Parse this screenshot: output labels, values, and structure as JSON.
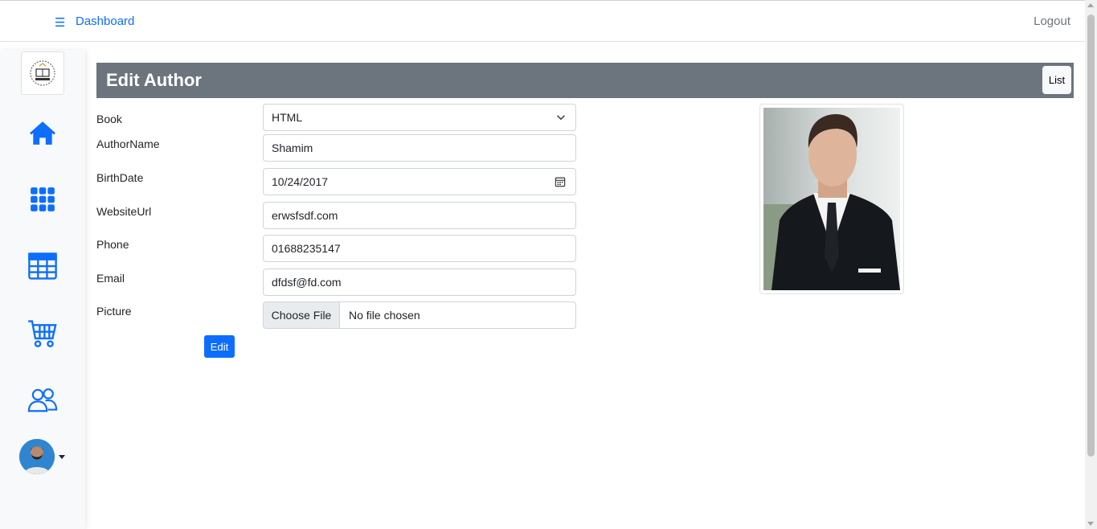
{
  "topbar": {
    "menu_icon": "hamburger-icon",
    "dashboard_label": "Dashboard",
    "logout_label": "Logout"
  },
  "sidebar": {
    "logo_icon": "library-logo",
    "items": [
      {
        "name": "home",
        "icon": "house-icon"
      },
      {
        "name": "grid",
        "icon": "grid-icon"
      },
      {
        "name": "table",
        "icon": "table-icon"
      },
      {
        "name": "cart",
        "icon": "cart-icon"
      },
      {
        "name": "users",
        "icon": "users-icon"
      }
    ],
    "avatar_icon": "user-avatar"
  },
  "page": {
    "title": "Edit Author",
    "list_label": "List"
  },
  "form": {
    "book": {
      "label": "Book",
      "value": "HTML"
    },
    "author_name": {
      "label": "AuthorName",
      "value": "Shamim"
    },
    "birth_date": {
      "label": "BirthDate",
      "value": "10/24/2017"
    },
    "website_url": {
      "label": "WebsiteUrl",
      "value": "erwsfsdf.com"
    },
    "phone": {
      "label": "Phone",
      "value": "01688235147"
    },
    "email": {
      "label": "Email",
      "value": "dfdsf@fd.com"
    },
    "picture": {
      "label": "Picture",
      "button_label": "Choose File",
      "status_text": "No file chosen"
    },
    "submit_label": "Edit"
  },
  "colors": {
    "accent": "#0d6efd",
    "header_bg": "#6c757d",
    "sidebar_bg": "#f8f9fa"
  }
}
